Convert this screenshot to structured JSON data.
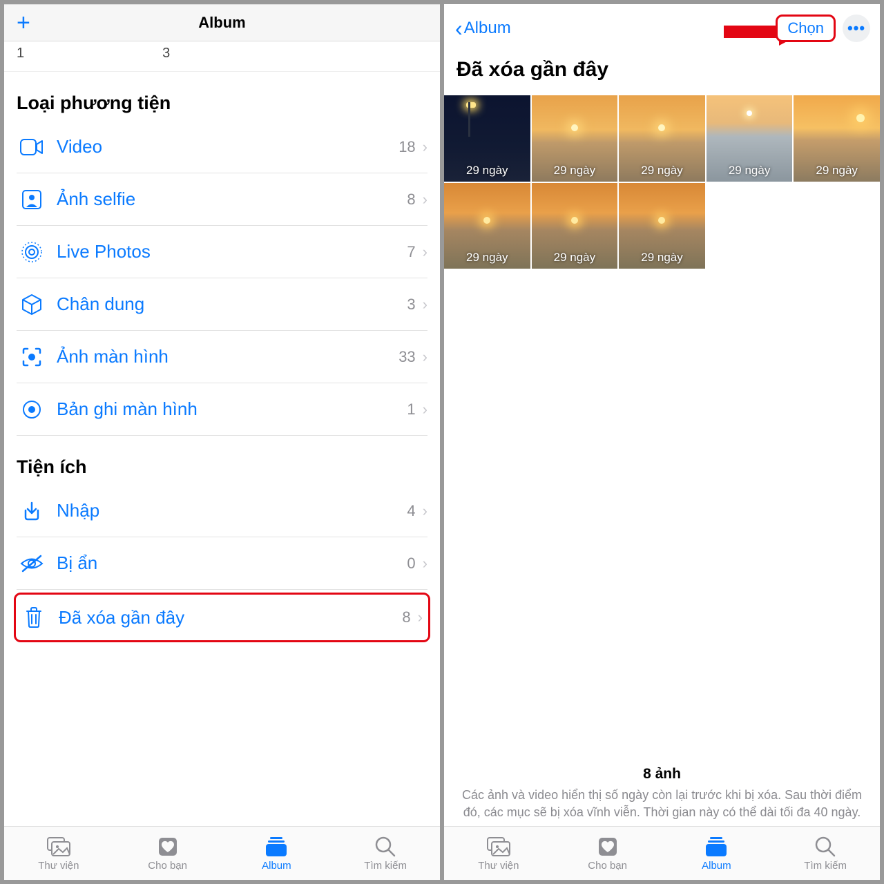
{
  "left": {
    "nav_title": "Album",
    "top_numbers": {
      "a": "1",
      "b": "3"
    },
    "section_media": "Loại phương tiện",
    "media_rows": [
      {
        "label": "Video",
        "count": "18"
      },
      {
        "label": "Ảnh selfie",
        "count": "8"
      },
      {
        "label": "Live Photos",
        "count": "7"
      },
      {
        "label": "Chân dung",
        "count": "3"
      },
      {
        "label": "Ảnh màn hình",
        "count": "33"
      },
      {
        "label": "Bản ghi màn hình",
        "count": "1"
      }
    ],
    "section_util": "Tiện ích",
    "util_rows": [
      {
        "label": "Nhập",
        "count": "4"
      },
      {
        "label": "Bị ẩn",
        "count": "0"
      },
      {
        "label": "Đã xóa gần đây",
        "count": "8"
      }
    ]
  },
  "right": {
    "back_label": "Album",
    "select_label": "Chọn",
    "title": "Đã xóa gần đây",
    "thumb_badge": "29 ngày",
    "footer_count": "8 ảnh",
    "footer_desc": "Các ảnh và video hiển thị số ngày còn lại trước khi bị xóa. Sau thời điểm đó, các mục sẽ bị xóa vĩnh viễn. Thời gian này có thể dài tối đa 40 ngày."
  },
  "tabs": {
    "library": "Thư viện",
    "for_you": "Cho bạn",
    "album": "Album",
    "search": "Tìm kiếm"
  }
}
